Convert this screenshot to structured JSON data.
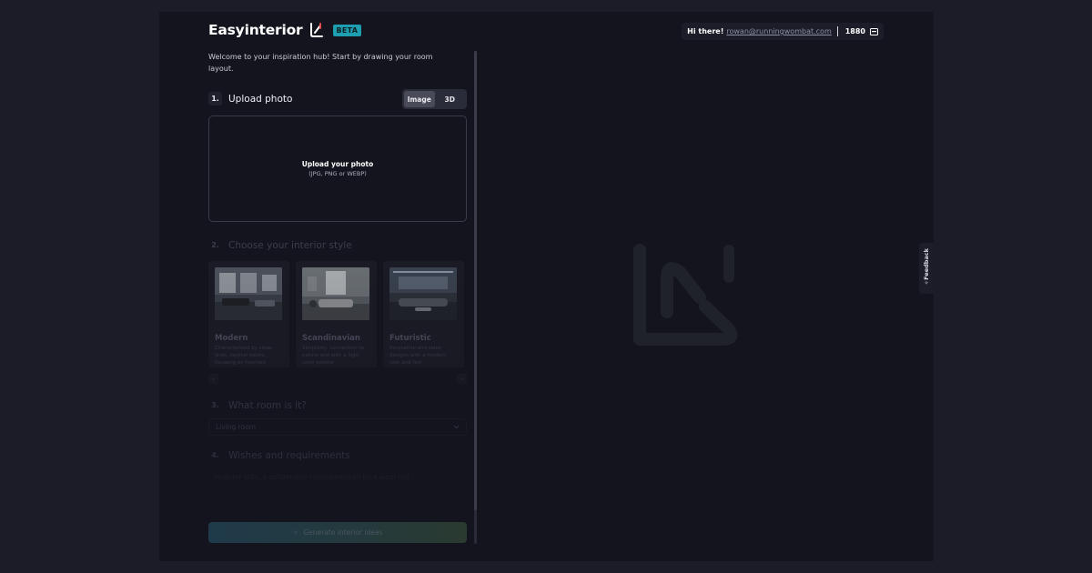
{
  "brand": {
    "name": "Easyinterior",
    "badge": "BETA"
  },
  "user": {
    "greeting": "Hi there!",
    "email": "rowan@runningwombat.com",
    "credits": "1880"
  },
  "intro": "Welcome to your inspiration hub! Start by drawing your room layout.",
  "steps": [
    {
      "num": "1.",
      "title": "Upload photo"
    },
    {
      "num": "2.",
      "title": "Choose your interior style"
    },
    {
      "num": "3.",
      "title": "What room is it?"
    },
    {
      "num": "4.",
      "title": "Wishes and requirements"
    }
  ],
  "mode_toggle": {
    "options": [
      "Image",
      "3D"
    ],
    "selected": "Image"
  },
  "upload": {
    "title": "Upload your photo",
    "subtitle": "(JPG, PNG or WEBP)"
  },
  "styles": [
    {
      "title": "Modern",
      "description": "Characterized by clean lines, neutral colors, focusing on function"
    },
    {
      "title": "Scandinavian",
      "description": "Simplicity, connection to nature and with a light color palette"
    },
    {
      "title": "Futuristic",
      "description": "Innovative and sleek designs with a modern look and feel"
    }
  ],
  "carousel": {
    "prev": "‹",
    "next": "›"
  },
  "room_select": {
    "value": "Living room"
  },
  "wishes": {
    "placeholder": "Modular sofa, a coffeetable complemented by a wool rug"
  },
  "generate": {
    "label": "Generate interior ideas"
  },
  "feedback": {
    "label": "Feedback"
  },
  "colors": {
    "accent": "#1e9fb1",
    "logo_red": "#e5484d",
    "background": "#13141d"
  },
  "icons": {
    "credits": "credit-card-icon",
    "feedback": "sparkle-icon",
    "generate": "sparkle-icon",
    "select": "chevron-down-icon"
  }
}
